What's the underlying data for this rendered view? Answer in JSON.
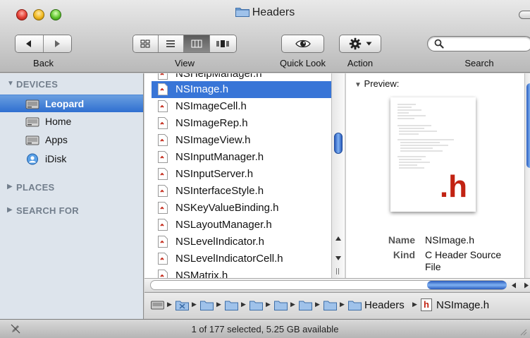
{
  "window": {
    "title": "Headers"
  },
  "toolbar": {
    "back_label": "Back",
    "view_label": "View",
    "quicklook_label": "Quick Look",
    "action_label": "Action",
    "search_label": "Search",
    "search_value": "",
    "view_modes": [
      "icon",
      "list",
      "column",
      "cover-flow"
    ],
    "active_view_mode": "column"
  },
  "sidebar": {
    "devices_header": "DEVICES",
    "devices": [
      {
        "label": "Leopard",
        "icon": "hard-drive-icon",
        "selected": true
      },
      {
        "label": "Home",
        "icon": "home-drive-icon",
        "selected": false
      },
      {
        "label": "Apps",
        "icon": "apps-drive-icon",
        "selected": false
      },
      {
        "label": "iDisk",
        "icon": "idisk-icon",
        "selected": false
      }
    ],
    "places_header": "PLACES",
    "search_for_header": "SEARCH FOR"
  },
  "files": {
    "partial_top": "NSHelpManager.h",
    "items": [
      "NSImage.h",
      "NSImageCell.h",
      "NSImageRep.h",
      "NSImageView.h",
      "NSInputManager.h",
      "NSInputServer.h",
      "NSInterfaceStyle.h",
      "NSKeyValueBinding.h",
      "NSLayoutManager.h",
      "NSLevelIndicator.h",
      "NSLevelIndicatorCell.h"
    ],
    "partial_bottom": "NSMatrix.h",
    "selected_index": 0
  },
  "preview": {
    "header": "Preview:",
    "thumbnail_ext": ".h",
    "name_key": "Name",
    "name_value": "NSImage.h",
    "kind_key": "Kind",
    "kind_value_line1": "C Header Source",
    "kind_value_line2": "File"
  },
  "pathbar": {
    "folder_label": "Headers",
    "file_label": "NSImage.h",
    "file_icon_letter": "h"
  },
  "status": {
    "text": "1 of 177 selected, 5.25 GB available"
  },
  "colors": {
    "selection_blue": "#3875d7",
    "sidebar_bg": "#dde4ec",
    "header_text": "#727e8c",
    "h_red": "#c22313"
  }
}
